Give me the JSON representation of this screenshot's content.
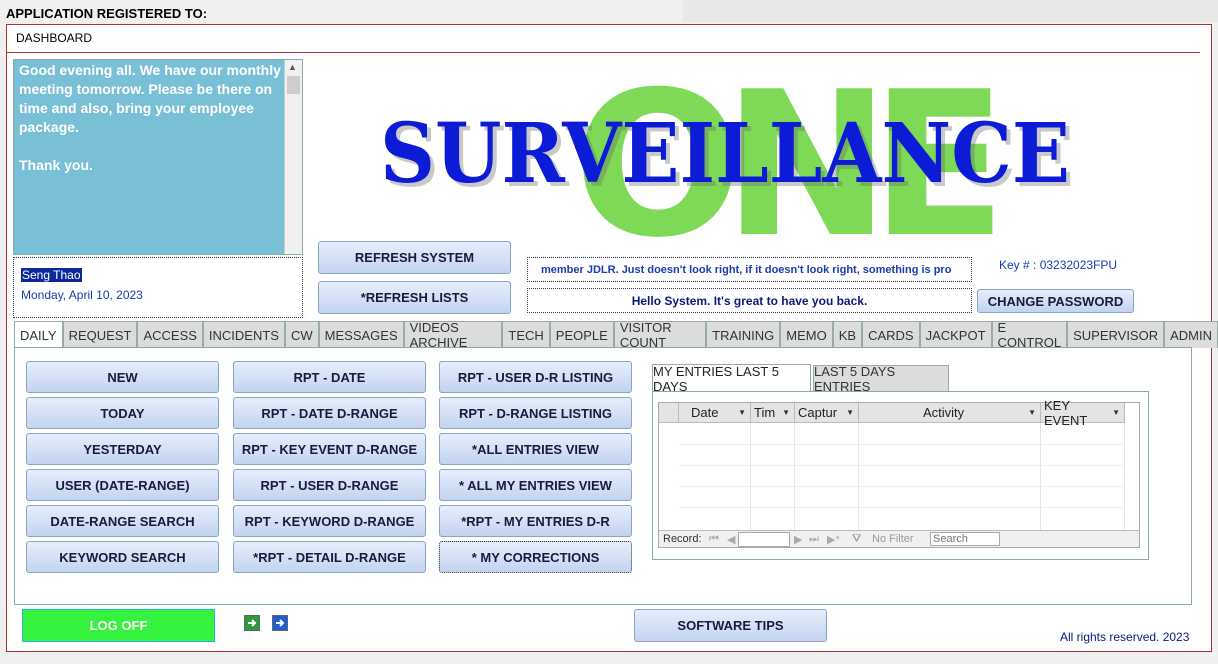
{
  "app": {
    "registered_label": "APPLICATION REGISTERED TO:",
    "form_title": "DASHBOARD"
  },
  "message": {
    "text": "Good evening all. We have our monthly meeting tomorrow. Please be there on time and also, bring your employee package.\n\nThank you.",
    "author": "Seng Thao",
    "date": "Monday, April 10, 2023"
  },
  "logo": {
    "word": "SURVEILLANCE",
    "overlay": "ONE",
    "word_color": "#0b1bd6",
    "overlay_color": "#7ed957"
  },
  "actions": {
    "refresh_system": "REFRESH SYSTEM",
    "refresh_lists": "*REFRESH LISTS",
    "change_password": "CHANGE PASSWORD",
    "log_off": "LOG OFF",
    "software_tips": "SOFTWARE TIPS"
  },
  "ticker": {
    "text": "member JDLR.   Just doesn't look right, if it doesn't look right, something is probably wrong."
  },
  "greeting": "Hello System.  It's great to have you back.",
  "key": "Key # : 03232023FPU",
  "tabs": [
    "DAILY",
    "REQUEST",
    "ACCESS",
    "INCIDENTS",
    "CW",
    "MESSAGES",
    "VIDEOS ARCHIVE",
    "TECH",
    "PEOPLE",
    "VISITOR COUNT",
    "TRAINING",
    "MEMO",
    "KB",
    "CARDS",
    "JACKPOT",
    "E CONTROL",
    "SUPERVISOR",
    "ADMIN"
  ],
  "daily": {
    "col1": [
      "NEW",
      "TODAY",
      "YESTERDAY",
      "USER (DATE-RANGE)",
      "DATE-RANGE SEARCH",
      "KEYWORD SEARCH"
    ],
    "col2": [
      "RPT - DATE",
      "RPT - DATE D-RANGE",
      "RPT - KEY EVENT D-RANGE",
      "RPT - USER D-RANGE",
      "RPT - KEYWORD D-RANGE",
      "*RPT - DETAIL D-RANGE"
    ],
    "col3": [
      "RPT - USER D-R LISTING",
      "RPT - D-RANGE LISTING",
      "*ALL ENTRIES VIEW",
      "* ALL MY ENTRIES VIEW",
      "*RPT - MY ENTRIES D-R",
      "* MY CORRECTIONS"
    ]
  },
  "entries": {
    "subtabs": [
      "MY ENTRIES LAST 5 DAYS",
      "LAST 5 DAYS ENTRIES"
    ],
    "columns": [
      "Date",
      "Tim",
      "Captur",
      "Activity",
      "KEY EVENT"
    ],
    "record_label": "Record:",
    "no_filter": "No Filter",
    "search_placeholder": "Search"
  },
  "footer": {
    "copyright": "All rights reserved. 2023"
  },
  "colors": {
    "frame_border": "#aa3333",
    "message_bg": "#79bfd6",
    "logoff_bg": "#35f23f",
    "link_blue": "#1a3bb0"
  }
}
